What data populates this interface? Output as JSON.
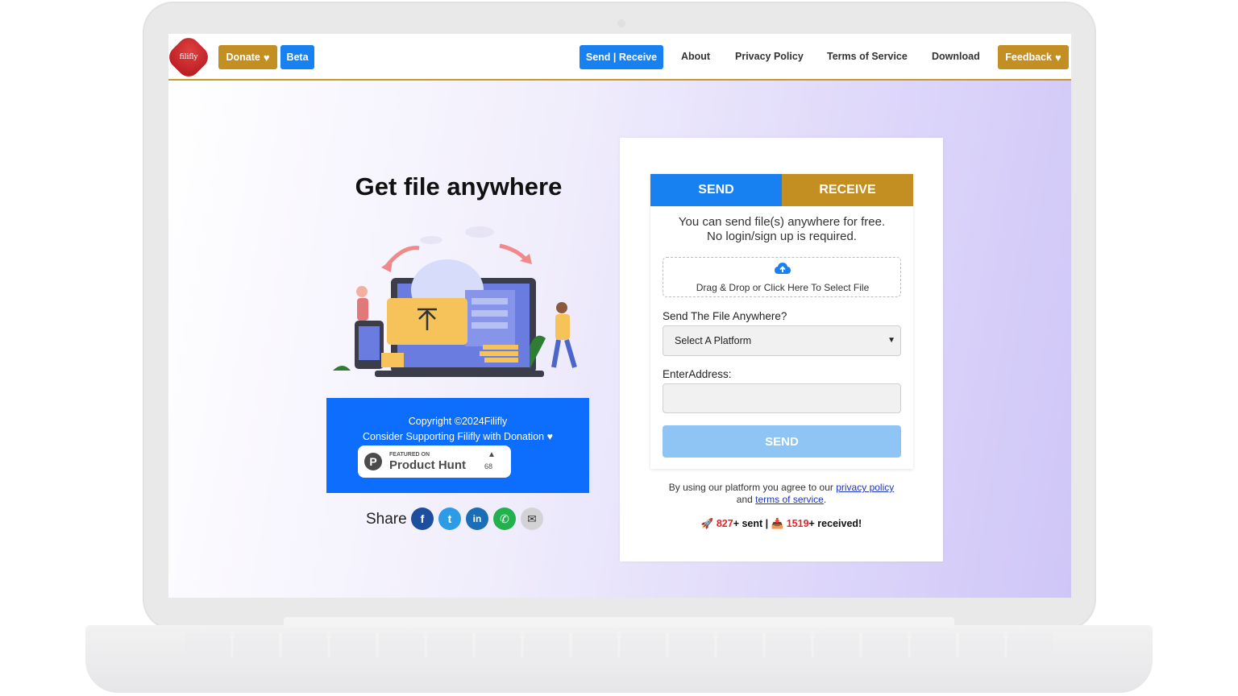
{
  "nav": {
    "logo_text": "filifly",
    "donate_label": "Donate",
    "beta_label": "Beta",
    "send_receive_label": "Send | Receive",
    "links": [
      "About",
      "Privacy Policy",
      "Terms of Service",
      "Download"
    ],
    "feedback_label": "Feedback"
  },
  "hero": {
    "headline": "Get file anywhere"
  },
  "footer_box": {
    "copyright": "Copyright ©2024Filifly",
    "support": "Consider Supporting Filifly with Donation ♥",
    "product_hunt": {
      "featured": "FEATURED ON",
      "name": "Product Hunt",
      "count": "68"
    }
  },
  "share": {
    "label": "Share",
    "icons": [
      "facebook-icon",
      "twitter-icon",
      "linkedin-icon",
      "whatsapp-icon",
      "email-icon"
    ]
  },
  "card": {
    "tabs": {
      "send": "SEND",
      "receive": "RECEIVE"
    },
    "intro_line1": "You can send file(s) anywhere for free.",
    "intro_line2": "No login/sign up is required.",
    "drop_text": "Drag & Drop or Click Here To Select File",
    "platform_label": "Send The File Anywhere?",
    "platform_selected": "Select A Platform",
    "address_label": "EnterAddress:",
    "address_value": "",
    "send_button": "SEND",
    "agree_prefix": "By using our platform you agree to our",
    "privacy_link": "privacy policy",
    "agree_and": "and",
    "terms_link": "terms of service",
    "agree_suffix": ".",
    "stats": {
      "sent_count": "827",
      "sent_label": "+ sent",
      "separator": "|",
      "received_count": "1519",
      "received_label": "+ received!"
    }
  },
  "colors": {
    "gold": "#c48f22",
    "blue": "#1781f2",
    "footer_blue": "#0d6efd",
    "send_disabled": "#8ec5f5"
  }
}
